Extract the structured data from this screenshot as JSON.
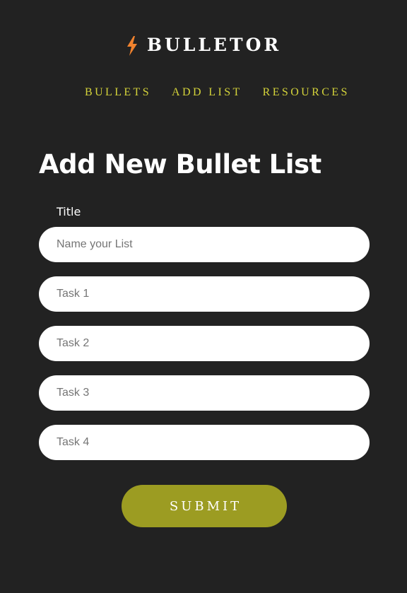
{
  "brand": {
    "name": "BULLETOR",
    "icon": "lightning-bolt-icon",
    "icon_color": "#f0822e"
  },
  "nav": {
    "items": [
      {
        "label": "BULLETS"
      },
      {
        "label": "ADD LIST"
      },
      {
        "label": "RESOURCES"
      }
    ],
    "color": "#d4d33a"
  },
  "form": {
    "heading": "Add New Bullet List",
    "title_label": "Title",
    "fields": [
      {
        "placeholder": "Name your List",
        "value": ""
      },
      {
        "placeholder": "Task 1",
        "value": ""
      },
      {
        "placeholder": "Task 2",
        "value": ""
      },
      {
        "placeholder": "Task 3",
        "value": ""
      },
      {
        "placeholder": "Task 4",
        "value": ""
      }
    ],
    "submit_label": "SUBMIT",
    "submit_color": "#9c9c22"
  },
  "colors": {
    "background": "#222222",
    "text": "#ffffff"
  }
}
